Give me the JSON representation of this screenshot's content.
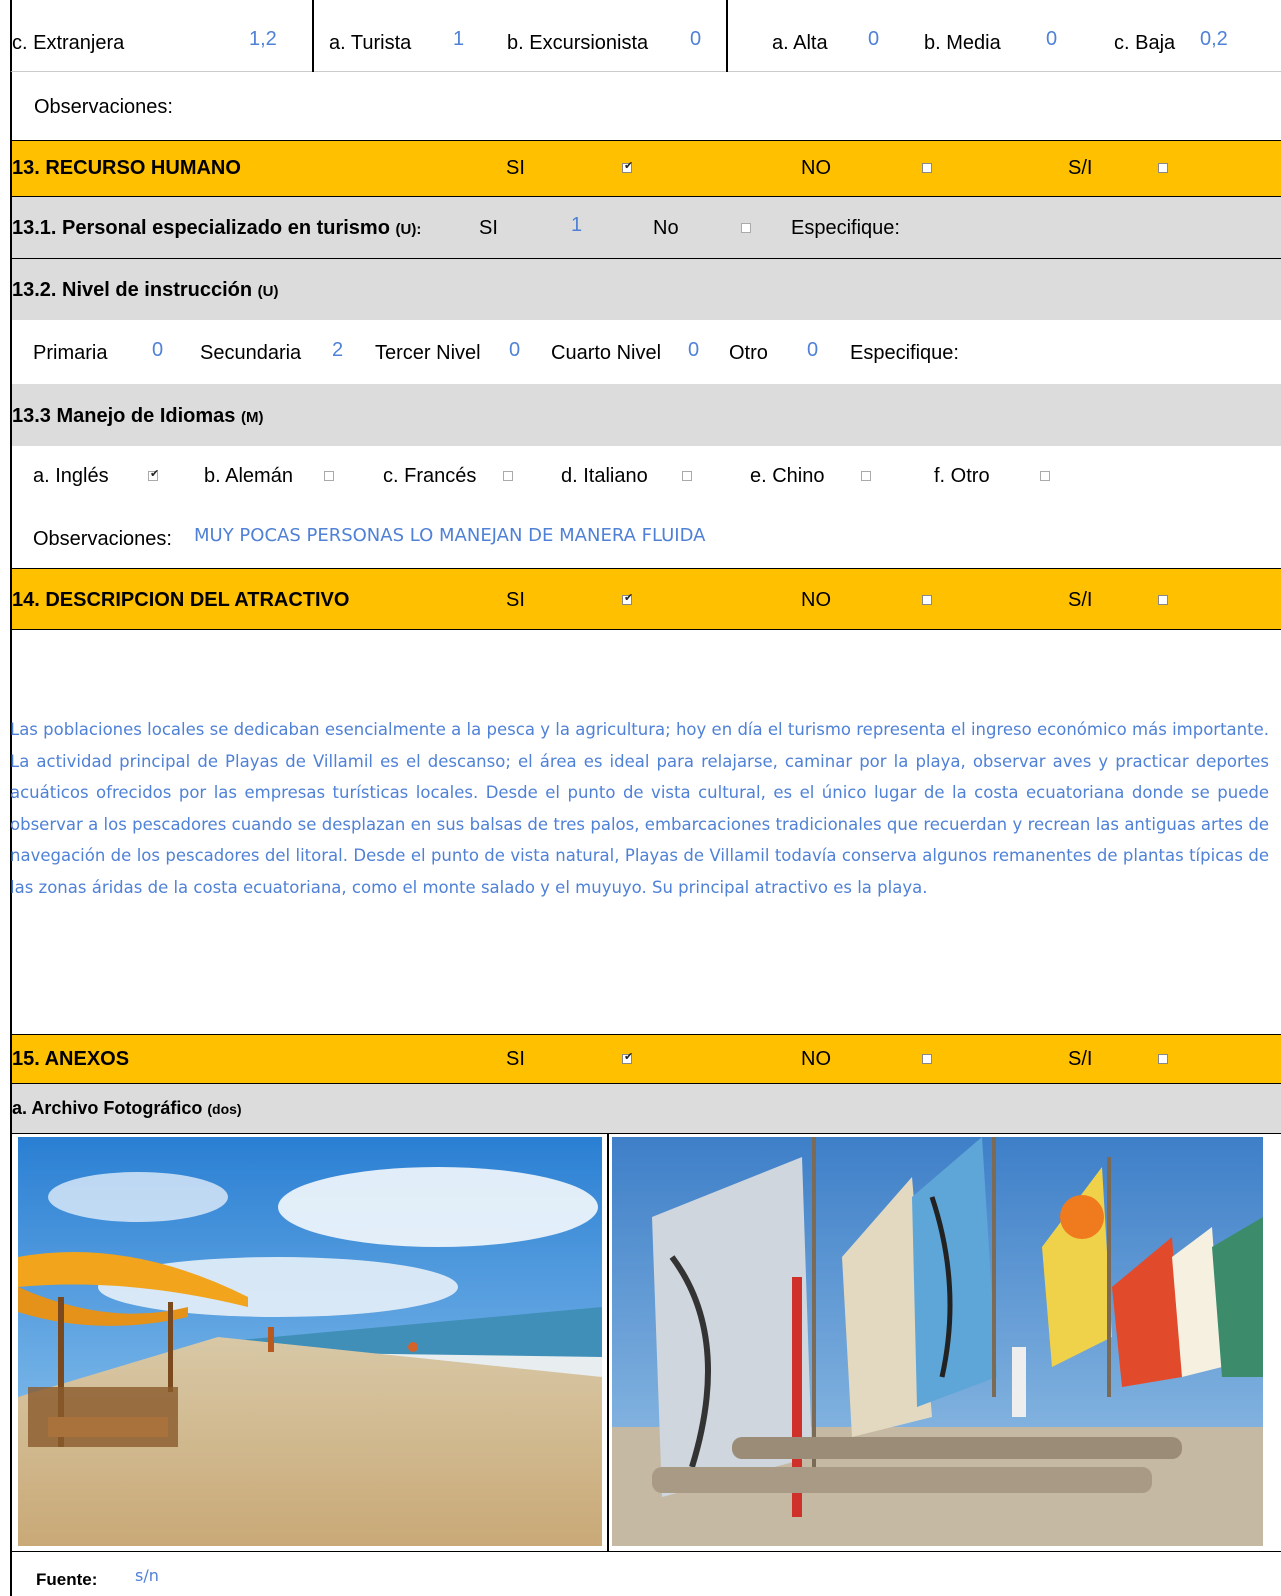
{
  "demand": {
    "extranjera_label": "c. Extranjera",
    "extranjera_value": "1,2",
    "turista_label": "a. Turista",
    "turista_value": "1",
    "excursionista_label": "b. Excursionista",
    "excursionista_value": "0",
    "alta_label": "a. Alta",
    "alta_value": "0",
    "media_label": "b. Media",
    "media_value": "0",
    "baja_label": "c. Baja",
    "baja_value": "0,2",
    "observaciones_label": "Observaciones:"
  },
  "s13": {
    "title": "13. RECURSO HUMANO",
    "si": "SI",
    "no": "NO",
    "si_ni": "S/I",
    "si_checked": true,
    "no_checked": false,
    "sin_checked": false,
    "personal_label": "13.1. Personal especializado en turismo",
    "personal_suffix": "(U):",
    "personal_si": "SI",
    "personal_value": "1",
    "personal_no": "No",
    "personal_especifique": "Especifique:",
    "nivel_label": "13.2. Nivel de instrucción",
    "nivel_suffix": "(U)",
    "primaria": "Primaria",
    "primaria_value": "0",
    "secundaria": "Secundaria",
    "secundaria_value": "2",
    "tercer": "Tercer Nivel",
    "tercer_value": "0",
    "cuarto": "Cuarto Nivel",
    "cuarto_value": "0",
    "otro": "Otro",
    "otro_value": "0",
    "nivel_especifique": "Especifique:",
    "idiomas_label": "13.3 Manejo de Idiomas",
    "idiomas_suffix": "(M)",
    "ingles": "a. Inglés",
    "aleman": "b. Alemán",
    "frances": "c. Francés",
    "italiano": "d. Italiano",
    "chino": "e. Chino",
    "otro_idioma": "f. Otro",
    "ingles_checked": true,
    "obs_label": "Observaciones:",
    "obs_value": "MUY POCAS PERSONAS LO MANEJAN DE MANERA FLUIDA"
  },
  "s14": {
    "title": "14. DESCRIPCION DEL ATRACTIVO",
    "si": "SI",
    "no": "NO",
    "si_ni": "S/I",
    "si_checked": true,
    "description": "Las poblaciones locales se dedicaban esencialmente a la pesca y la agricultura; hoy en día el turismo representa el ingreso económico más importante. La actividad principal de Playas de Villamil es el descanso; el área es ideal para relajarse, caminar por la playa, observar aves y practicar deportes acuáticos ofrecidos por las empresas turísticas locales. Desde el punto de vista cultural, es el único lugar de la costa ecuatoriana donde se puede observar a los pescadores cuando se desplazan en sus balsas de tres palos, embarcaciones tradicionales que recuerdan y recrean las antiguas artes de navegación de los pescadores del litoral. Desde el punto de vista natural, Playas de Villamil todavía conserva algunos remanentes de plantas típicas de las zonas áridas de la costa ecuatoriana, como el monte salado y el muyuyo. Su principal atractivo es la playa."
  },
  "s15": {
    "title": "15. ANEXOS",
    "si": "SI",
    "no": "NO",
    "si_ni": "S/I",
    "si_checked": true,
    "archivo_label": "a. Archivo Fotográfico",
    "archivo_suffix": "(dos)",
    "fuente_label": "Fuente:",
    "fuente_value": "s/n"
  },
  "colors": {
    "section_header": "#ffc000",
    "subheader": "#dcdcdc",
    "handwritten": "#4f81d6"
  }
}
